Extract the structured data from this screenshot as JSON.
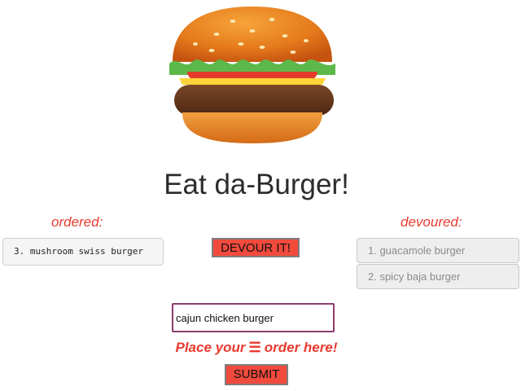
{
  "header": {
    "logo_icon": "burger-icon",
    "title": "Eat da-Burger!"
  },
  "ordered": {
    "heading": "ordered:",
    "items": [
      {
        "label": "3. mushroom swiss burger"
      }
    ]
  },
  "devour_button": {
    "label": "DEVOUR IT!",
    "color": "#f24a3c"
  },
  "devoured": {
    "heading": "devoured:",
    "items": [
      {
        "label": "1. guacamole burger"
      },
      {
        "label": "2. spicy baja burger"
      }
    ]
  },
  "order_form": {
    "input_value": "cajun chicken burger",
    "prompt_before": "Place your",
    "prompt_icon": "menu-icon",
    "prompt_icon_glyph": "☰",
    "prompt_after": "order here!",
    "submit_label": "SUBMIT"
  },
  "colors": {
    "accent": "#e83a2f",
    "button": "#f24a3c"
  }
}
